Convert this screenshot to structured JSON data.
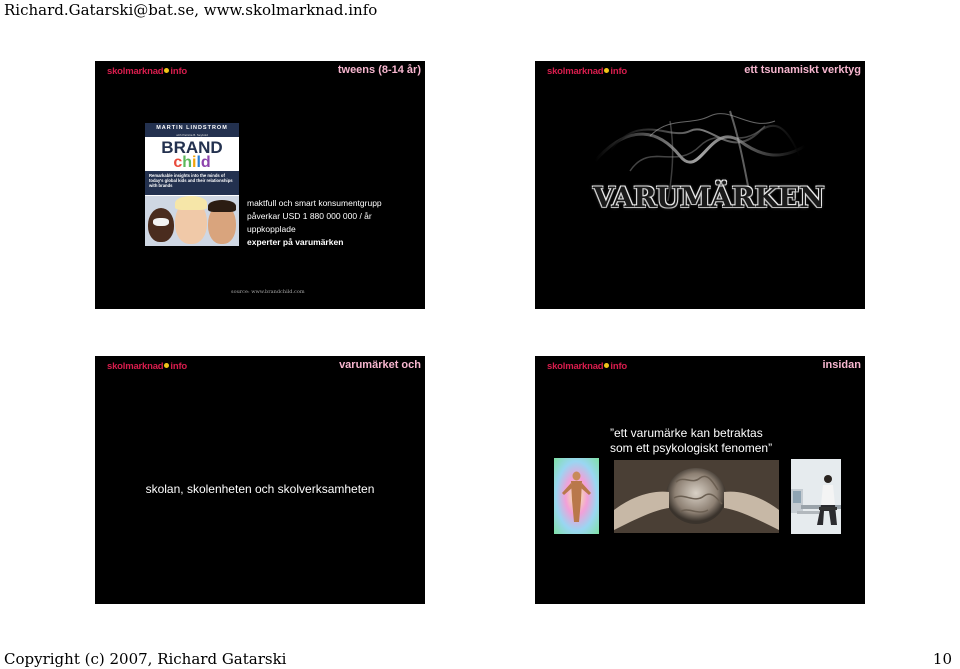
{
  "header": {
    "text": "Richard.Gatarski@bat.se, www.skolmarknad.info"
  },
  "footer": {
    "copyright": "Copyright (c) 2007, Richard Gatarski",
    "page": "10"
  },
  "logo": {
    "left": "skolmarknad",
    "right": "info"
  },
  "slides": [
    {
      "title": "tweens (8-14 år)",
      "book": {
        "author": "MARTIN LINDSTROM",
        "coauthor": "with Patricia B. Seybold",
        "brand": "BRAND",
        "child": [
          "c",
          "h",
          "i",
          "l",
          "d"
        ],
        "tagline": "Remarkable insights into the minds of today's global kids and their relationships with brands"
      },
      "lines": [
        "maktfull och smart konsumentgrupp",
        "påverkar USD 1 880 000 000 / år",
        "uppkopplade",
        "experter på varumärken"
      ],
      "source": "source: www.brandchild.com"
    },
    {
      "title": "ett tsunamiskt verktyg",
      "wordmark": "VARUMÄRKEN"
    },
    {
      "title": "varumärket och",
      "body": "skolan, skolenheten och skolverksamheten"
    },
    {
      "title": "insidan",
      "quote": [
        "”ett varumärke kan betraktas",
        "som ett psykologiskt fenomen”"
      ]
    }
  ]
}
